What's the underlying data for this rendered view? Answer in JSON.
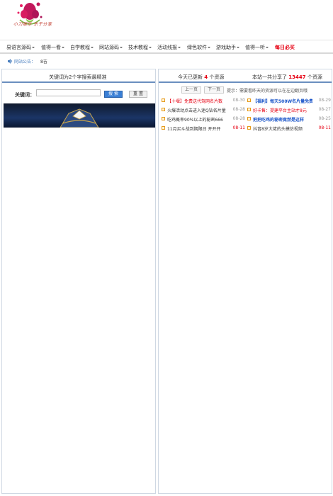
{
  "header": {
    "logo_text": "小刀娱乐 乐于分享"
  },
  "nav": {
    "items": [
      {
        "label": "易语言源码",
        "caret": true
      },
      {
        "label": "值得一看",
        "caret": true
      },
      {
        "label": "自学教程",
        "caret": true
      },
      {
        "label": "网站源码",
        "caret": true
      },
      {
        "label": "技术教程",
        "caret": true
      },
      {
        "label": "活动线报",
        "caret": true
      },
      {
        "label": "绿色软件",
        "caret": true
      },
      {
        "label": "游戏助手",
        "caret": true
      },
      {
        "label": "值得一听",
        "caret": true
      },
      {
        "label": "每日必买",
        "caret": false,
        "hot": true
      }
    ]
  },
  "notice": {
    "label": "网站公告：",
    "value": "8吉"
  },
  "search_panel": {
    "title": "关键词为2个字搜索最精准",
    "keyword_label": "关键词：",
    "input_value": "",
    "search_button": "搜 索",
    "reset_button": "重 置"
  },
  "resource_panel": {
    "today_prefix": "今天已更新",
    "today_count": "4",
    "today_suffix": "个资源",
    "total_prefix": "本站一共分享了",
    "total_count": "13447",
    "total_suffix": "个资源",
    "prev_button": "上一页",
    "next_button": "下一页",
    "tip": "提示：需要看昨天的资源可以在左边翻页哦",
    "left_items": [
      {
        "title": "【十堰】免费送代驾网名片数",
        "date": "08-30",
        "style": "hl-red",
        "date_red": false
      },
      {
        "title": "火爆活动点击进入迷Q钻名片量",
        "date": "08-28",
        "style": "",
        "date_red": false
      },
      {
        "title": "吃鸡概率90%以上的秘密666",
        "date": "08-28",
        "style": "",
        "date_red": false
      },
      {
        "title": "11月买斗战到期限日 开开开",
        "date": "08-11",
        "style": "",
        "date_red": true
      }
    ],
    "right_items": [
      {
        "title": "【福利】每天500W名片量免费",
        "date": "08-29",
        "style": "hl-blue",
        "date_red": false
      },
      {
        "title": "好卡售：提建平台主站才8元",
        "date": "08-27",
        "style": "hl-red",
        "date_red": false
      },
      {
        "title": "把把吃鸡的秘密竟然是这样",
        "date": "08-25",
        "style": "hl-blue",
        "date_red": false
      },
      {
        "title": "抖音8岁大佬的头模仿视频",
        "date": "08-11",
        "style": "",
        "date_red": true
      }
    ]
  },
  "colors": {
    "accent_blue": "#3a7fd5",
    "hot_red": "#e60012",
    "panel_border": "#6a8fbf"
  }
}
